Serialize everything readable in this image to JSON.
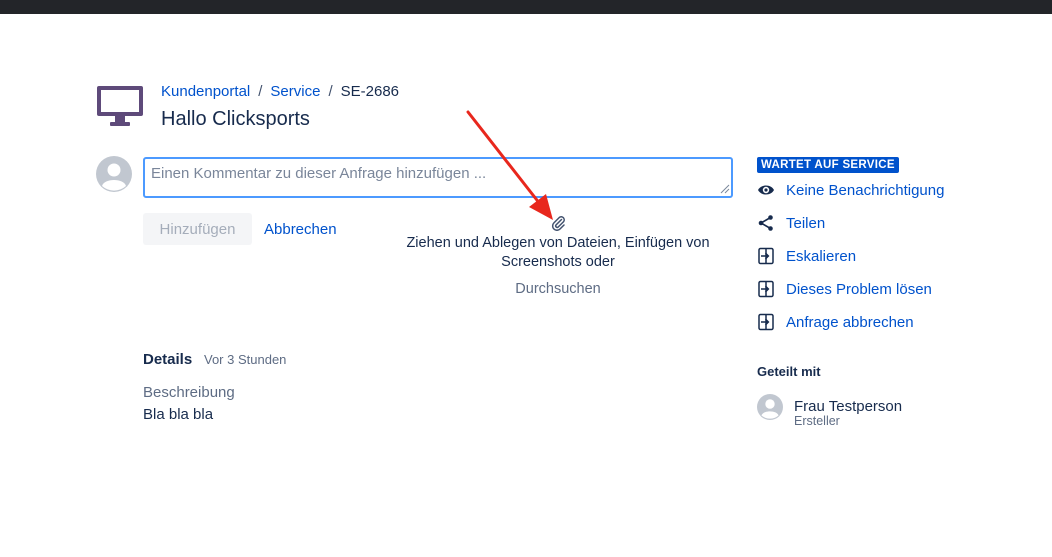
{
  "breadcrumb": {
    "portal": "Kundenportal",
    "separator": "/",
    "service": "Service",
    "issue_key": "SE-2686"
  },
  "request": {
    "title": "Hallo Clicksports"
  },
  "comment": {
    "placeholder": "Einen Kommentar zu dieser Anfrage hinzufügen ...",
    "value": "",
    "add_label": "Hinzufügen",
    "cancel_label": "Abbrechen"
  },
  "attachment": {
    "icon": "paperclip-icon",
    "drop_text": "Ziehen und Ablegen von Dateien, Einfügen von Screenshots oder",
    "browse_label": "Durchsuchen"
  },
  "sidebar": {
    "status": "WARTET AUF SERVICE",
    "actions": [
      {
        "icon": "eye-icon",
        "label": "Keine Benachrichtigung"
      },
      {
        "icon": "share-icon",
        "label": "Teilen"
      },
      {
        "icon": "transition-icon",
        "label": "Eskalieren"
      },
      {
        "icon": "transition-icon",
        "label": "Dieses Problem lösen"
      },
      {
        "icon": "transition-icon",
        "label": "Anfrage abbrechen"
      }
    ],
    "shared_heading": "Geteilt mit",
    "shared_with": {
      "name": "Frau Testperson",
      "role": "Ersteller"
    }
  },
  "details": {
    "heading": "Details",
    "time": "Vor 3 Stunden",
    "description_label": "Beschreibung",
    "description": "Bla bla bla"
  },
  "colors": {
    "link": "#0052cc",
    "status_bg": "#0052cc",
    "focus_border": "#4c9aff",
    "annotation_arrow": "#e8271d",
    "portal_icon": "#5e4a7a"
  }
}
